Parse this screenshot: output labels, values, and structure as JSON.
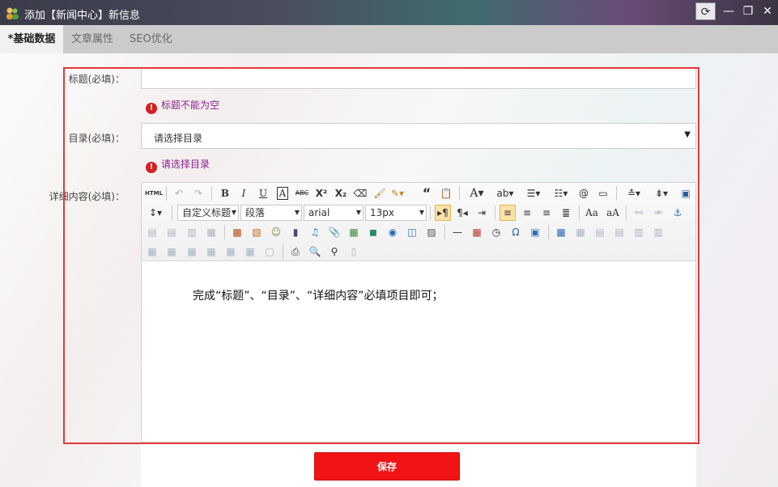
{
  "window": {
    "title": "添加【新闻中心】新信息",
    "refresh_icon": "⟳",
    "minimize_icon": "—",
    "maximize_icon": "❐",
    "close_icon": "✕"
  },
  "tabs": [
    {
      "label": "*基础数据"
    },
    {
      "label": "文章属性"
    },
    {
      "label": "SEO优化"
    }
  ],
  "form": {
    "title_label": "标题(必填)：",
    "title_value": "",
    "title_error": "标题不能为空",
    "catalog_label": "目录(必填)：",
    "catalog_value": "请选择目录",
    "catalog_error": "请选择目录",
    "content_label": "详细内容(必填)：",
    "content_text": "完成“标题”、“目录”、“详细内容”必填项目即可；"
  },
  "editor_toolbar": {
    "html": "HTML",
    "custom_title": "自定义标题",
    "paragraph": "段落",
    "font_family": "arial",
    "font_size": "13px"
  },
  "save_label": "保存",
  "colors": {
    "accent": "#f01414",
    "error_text": "#8b1f8b",
    "highlight_border": "#e03a3a"
  }
}
